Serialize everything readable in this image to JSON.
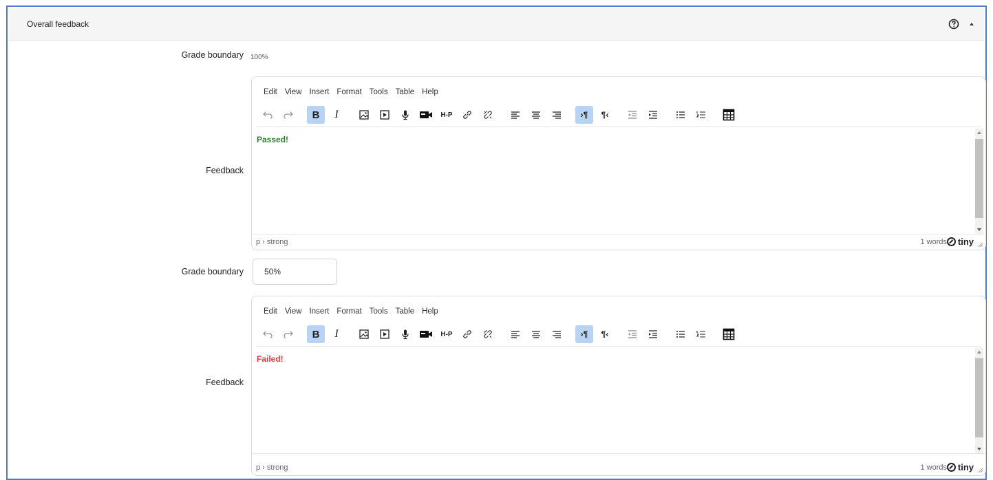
{
  "section": {
    "title": "Overall feedback"
  },
  "grade_boundary_1": {
    "label": "Grade boundary",
    "value": "100%"
  },
  "feedback_1": {
    "label": "Feedback",
    "content": "Passed!",
    "content_color": "#2e7d32",
    "path": "p › strong",
    "word_count": "1 words"
  },
  "grade_boundary_2": {
    "label": "Grade boundary",
    "value": "50%"
  },
  "feedback_2": {
    "label": "Feedback",
    "content": "Failed!",
    "content_color": "#e53935",
    "path": "p › strong",
    "word_count": "1 words"
  },
  "editor": {
    "menu": [
      "Edit",
      "View",
      "Insert",
      "Format",
      "Tools",
      "Table",
      "Help"
    ],
    "brand": "tiny"
  },
  "colors": {
    "frame_border": "#4a7cc9",
    "active_button": "#b9d3f5"
  }
}
